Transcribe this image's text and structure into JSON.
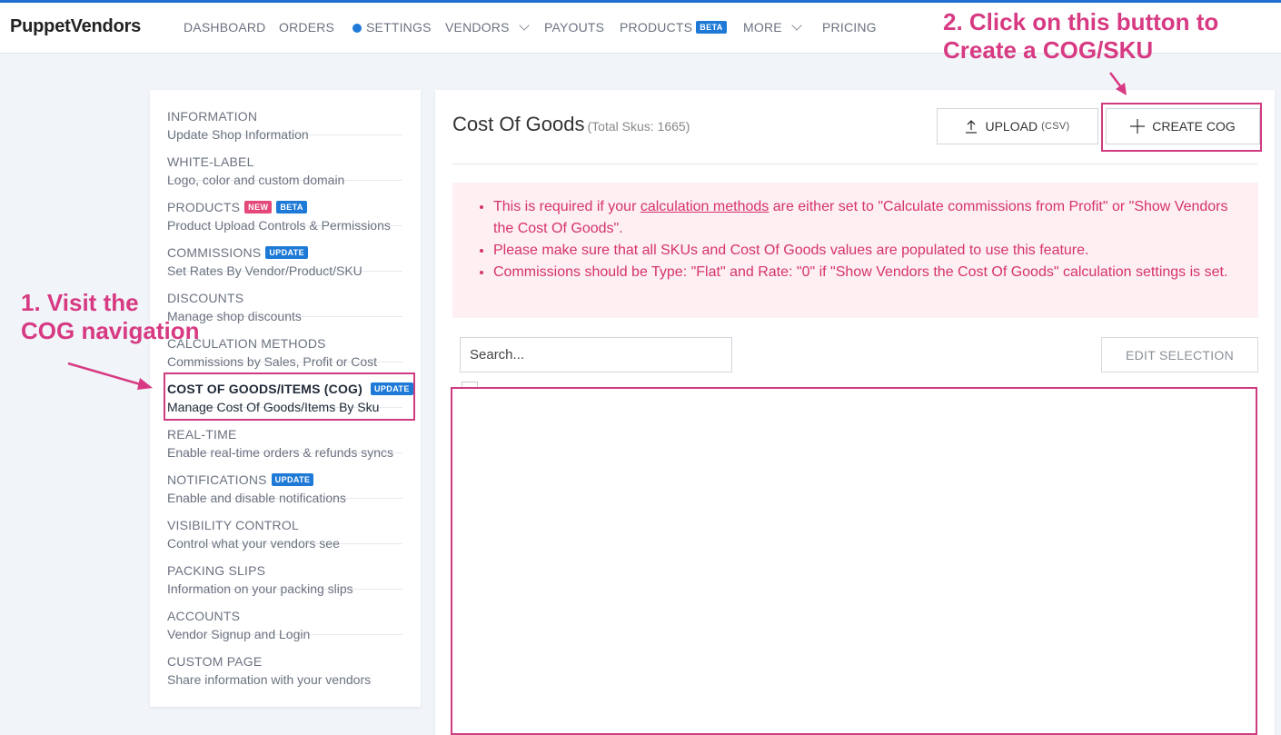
{
  "brand": "PuppetVendors",
  "nav": {
    "dashboard": "DASHBOARD",
    "orders": "ORDERS",
    "settings": "SETTINGS",
    "vendors": "VENDORS",
    "payouts": "PAYOUTS",
    "products": "PRODUCTS",
    "products_badge": "BETA",
    "more": "MORE",
    "pricing": "PRICING"
  },
  "sidebar": {
    "items": [
      {
        "title": "INFORMATION",
        "subtitle": "Update Shop Information"
      },
      {
        "title": "WHITE-LABEL",
        "subtitle": "Logo, color and custom domain"
      },
      {
        "title": "PRODUCTS",
        "subtitle": "Product Upload Controls & Permissions",
        "badge_new": "NEW",
        "badge_beta": "BETA"
      },
      {
        "title": "COMMISSIONS",
        "subtitle": "Set Rates By Vendor/Product/SKU",
        "badge": "UPDATE"
      },
      {
        "title": "DISCOUNTS",
        "subtitle": "Manage shop discounts"
      },
      {
        "title": "CALCULATION METHODS",
        "subtitle": "Commissions by Sales, Profit or Cost"
      },
      {
        "title": "COST OF GOODS/ITEMS (COG)",
        "subtitle": "Manage Cost Of Goods/Items By Sku",
        "badge": "UPDATE"
      },
      {
        "title": "REAL-TIME",
        "subtitle": "Enable real-time orders & refunds syncs"
      },
      {
        "title": "NOTIFICATIONS",
        "subtitle": "Enable and disable notifications",
        "badge": "UPDATE"
      },
      {
        "title": "VISIBILITY CONTROL",
        "subtitle": "Control what your vendors see"
      },
      {
        "title": "PACKING SLIPS",
        "subtitle": "Information on your packing slips"
      },
      {
        "title": "ACCOUNTS",
        "subtitle": "Vendor Signup and Login"
      },
      {
        "title": "CUSTOM PAGE",
        "subtitle": "Share information with your vendors"
      }
    ]
  },
  "main": {
    "title": "Cost Of Goods",
    "total": "(Total Skus: 1665)",
    "upload_label": "UPLOAD",
    "upload_sub": "(CSV)",
    "create_label": "CREATE COG",
    "alert": {
      "item1_pre": "This is required if your ",
      "item1_link": "calculation methods",
      "item1_post": " are either set to \"Calculate commissions from Profit\" or \"Show Vendors the Cost Of Goods\".",
      "item2": "Please make sure that all SKUs and Cost Of Goods values are populated to use this feature.",
      "item3": "Commissions should be Type: \"Flat\" and Rate: \"0\" if \"Show Vendors the Cost Of Goods\" calculation settings is set."
    },
    "search_placeholder": "Search...",
    "edit_selection": "EDIT SELECTION"
  },
  "annotations": {
    "step1_line1": "1. Visit the",
    "step1_line2": "COG navigation",
    "step2_line1": "2. Click on this button to",
    "step2_line2": "Create a COG/SKU",
    "color": "#d73a82"
  },
  "colors": {
    "accent": "#1e7ad6",
    "badge_new": "#e5497a",
    "alert_text": "#d6336c",
    "alert_bg": "#fdeff2"
  }
}
